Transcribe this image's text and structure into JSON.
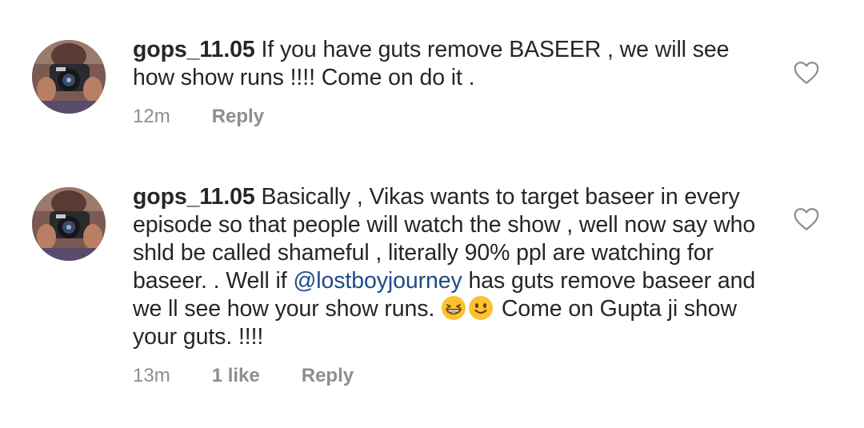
{
  "comments": [
    {
      "username": "gops_11.05",
      "text_parts": [
        "If you have guts remove BASEER , we will see how show runs !!!! Come on do it ."
      ],
      "time": "12m",
      "reply_label": "Reply"
    },
    {
      "username": "gops_11.05",
      "text_before_mention": "Basically , Vikas wants to target baseer in every episode so that people will watch the show ,  well now say who shld be called shameful , literally 90% ppl are watching for baseer. . Well if ",
      "mention": "@lostboyjourney",
      "text_after_mention": " has guts remove baseer and we ll see how your show runs. ",
      "emojis": [
        "grinning-squinting-face",
        "slightly-smiling-face"
      ],
      "text_after_emoji": " Come on Gupta ji show your guts.  !!!!",
      "time": "13m",
      "likes": "1 like",
      "reply_label": "Reply"
    }
  ],
  "colors": {
    "text": "#262626",
    "meta": "#8e8e8e",
    "mention": "#1f4a8a",
    "heart_outline": "#8e8e8e",
    "emoji": "#fdc02f"
  },
  "icons": {
    "like": "heart-outline-icon"
  }
}
